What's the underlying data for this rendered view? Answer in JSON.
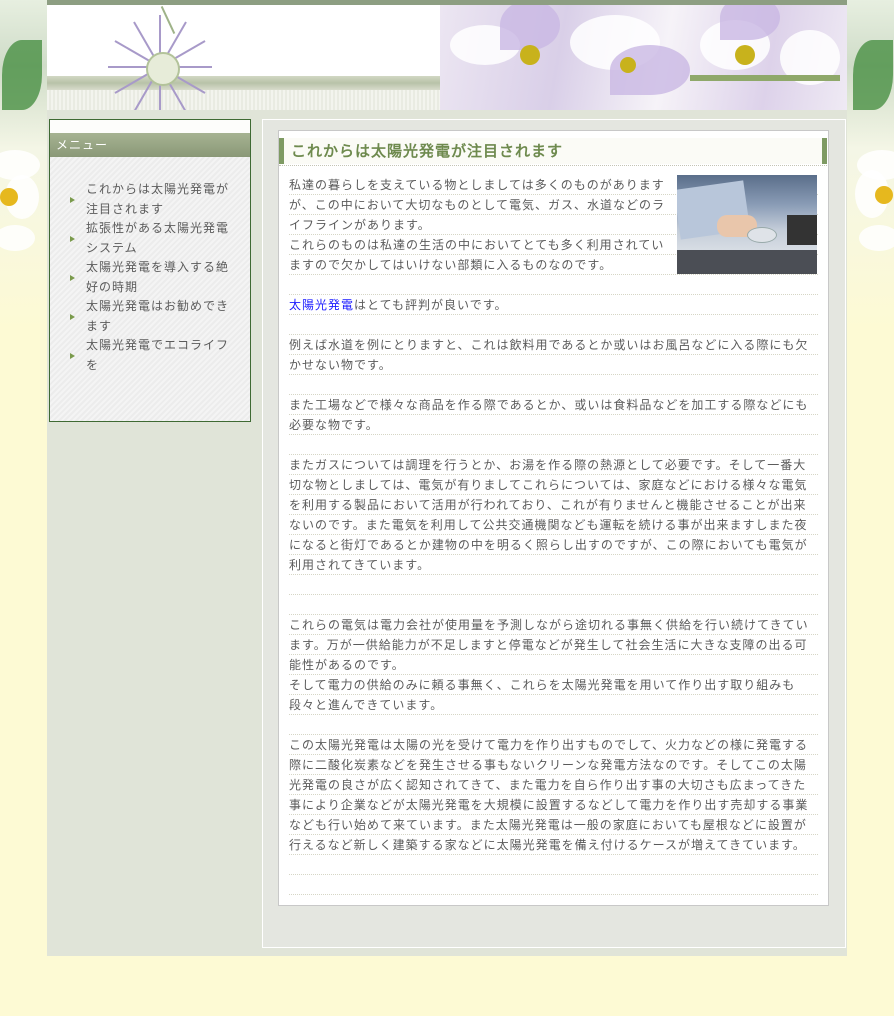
{
  "menu": {
    "heading": "メニュー",
    "items": [
      {
        "line1": "これからは太陽光発電が",
        "line2": "注目されます"
      },
      {
        "line1": "拡張性がある太陽光発電",
        "line2": "システム"
      },
      {
        "line1": "太陽光発電を導入する絶",
        "line2": "好の時期"
      },
      {
        "line1": "太陽光発電はお勧めでき",
        "line2": "ます"
      },
      {
        "line1": "太陽光発電でエコライフ",
        "line2": "を"
      }
    ]
  },
  "main": {
    "title": "これからは太陽光発電が注目されます",
    "intro": [
      "私達の暮らしを支えている物としましては多くのものがあります",
      "が、この中において大切なものとして電気、ガス、水道などのラ",
      "イフラインがあります。",
      "これらのものは私達の生活の中においてとても多く利用されてい",
      "ますので欠かしてはいけない部類に入るものなのです。"
    ],
    "link_text": "太陽光発電",
    "link_suffix": "はとても評判が良いです。",
    "p1": [
      "例えば水道を例にとりますと、これは飲料用であるとか或いはお風呂などに入る際にも欠",
      "かせない物です。"
    ],
    "p2": [
      "また工場などで様々な商品を作る際であるとか、或いは食料品などを加工する際などにも",
      "必要な物です。"
    ],
    "p3": [
      "またガスについては調理を行うとか、お湯を作る際の熱源として必要です。そして一番大",
      "切な物としましては、電気が有りましてこれらについては、家庭などにおける様々な電気",
      "を利用する製品において活用が行われており、これが有りませんと機能させることが出来",
      "ないのです。また電気を利用して公共交通機関なども運転を続ける事が出来ますしまた夜",
      "になると街灯であるとか建物の中を明るく照らし出すのですが、この際においても電気が",
      "利用されてきています。"
    ],
    "p4": [
      "これらの電気は電力会社が使用量を予測しながら途切れる事無く供給を行い続けてきてい",
      "ます。万が一供給能力が不足しますと停電などが発生して社会生活に大きな支障の出る可",
      "能性があるのです。",
      "そして電力の供給のみに頼る事無く、これらを太陽光発電を用いて作り出す取り組みも",
      "段々と進んできています。"
    ],
    "p5": [
      "この太陽光発電は太陽の光を受けて電力を作り出すものでして、火力などの様に発電する",
      "際に二酸化炭素などを発生させる事もないクリーンな発電方法なのです。そしてこの太陽",
      "光発電の良さが広く認知されてきて、また電力を自ら作り出す事の大切さも広まってきた",
      "事により企業などが太陽光発電を大規模に設置するなどして電力を作り出す売却する事業",
      "なども行い始めて来ています。また太陽光発電は一般の家庭においても屋根などに設置が",
      "行えるなど新しく建築する家などに太陽光発電を備え付けるケースが増えてきています。"
    ]
  },
  "colors": {
    "page_bg": "#fdfad4",
    "title_text": "#6e8a4e",
    "title_border": "#7e9a63",
    "link": "#1a1aff",
    "menu_header_bg": "#8a9877"
  }
}
